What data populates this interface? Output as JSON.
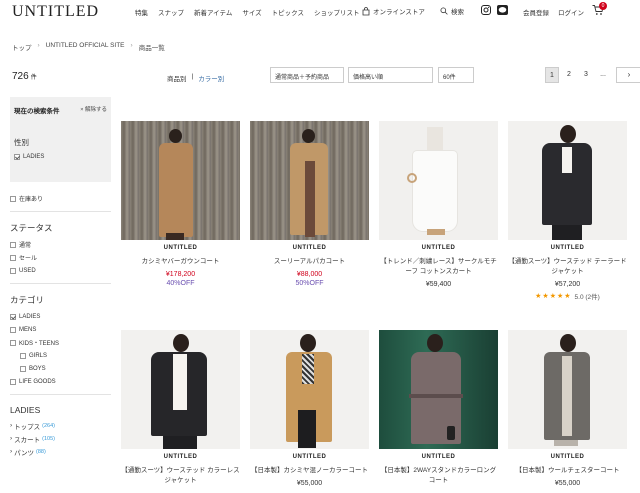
{
  "header": {
    "logo": "UNTITLED",
    "nav": [
      "特集",
      "スナップ",
      "新着アイテム",
      "サイズ",
      "トピックス",
      "ショップリスト"
    ],
    "online_store": "オンラインストア",
    "search": "検索",
    "register": "会員登録",
    "login": "ログイン",
    "cart_count": "0"
  },
  "breadcrumb": [
    "トップ",
    "UNTITLED OFFICIAL SITE",
    "商品一覧"
  ],
  "toolbar": {
    "count": "726",
    "count_unit": "件",
    "view_product": "商品別",
    "view_sep": "|",
    "view_color": "カラー別",
    "filter_select": "通常商品＋予約商品",
    "sort_select": "価格高い順",
    "per_page": "60件",
    "pages": [
      "1",
      "2",
      "3",
      "..."
    ],
    "next": "›"
  },
  "sidebar": {
    "current_title": "現在の検索条件",
    "reset": "× 解除する",
    "sex_label": "性別",
    "sex_value": "LADIES",
    "stock": "在庫あり",
    "status_title": "ステータス",
    "status": [
      "通常",
      "セール",
      "USED"
    ],
    "category_title": "カテゴリ",
    "categories": [
      "LADIES",
      "MENS",
      "KIDS・TEENS",
      "GIRLS",
      "BOYS",
      "LIFE GOODS"
    ],
    "ladies_title": "LADIES",
    "ladies_links": [
      {
        "label": "トップス",
        "count": "(264)"
      },
      {
        "label": "スカート",
        "count": "(105)"
      },
      {
        "label": "パンツ",
        "count": "(88)"
      }
    ]
  },
  "products": [
    {
      "brand": "UNTITLED",
      "name": "カシミヤバーガウンコート",
      "price": "¥178,200",
      "off": "40%OFF"
    },
    {
      "brand": "UNTITLED",
      "name": "スーリーアルパカコート",
      "price": "¥88,000",
      "off": "50%OFF"
    },
    {
      "brand": "UNTITLED",
      "name": "【トレンド／刺繍レース】サークルモチーフ コットンスカート",
      "price": "¥59,400"
    },
    {
      "brand": "UNTITLED",
      "name": "【通勤スーツ】ウーステッド テーラードジャケット",
      "price": "¥57,200",
      "rating": "5.0 (2件)"
    },
    {
      "brand": "UNTITLED",
      "name": "【通勤スーツ】ウーステッド カラーレスジャケット",
      "price": ""
    },
    {
      "brand": "UNTITLED",
      "name": "【日本製】カシミヤ混ノーカラーコート",
      "price": "¥55,000"
    },
    {
      "brand": "UNTITLED",
      "name": "【日本製】2WAYスタンドカラーロングコート",
      "price": ""
    },
    {
      "brand": "UNTITLED",
      "name": "【日本製】ウールチェスターコート",
      "price": "¥55,000"
    }
  ]
}
